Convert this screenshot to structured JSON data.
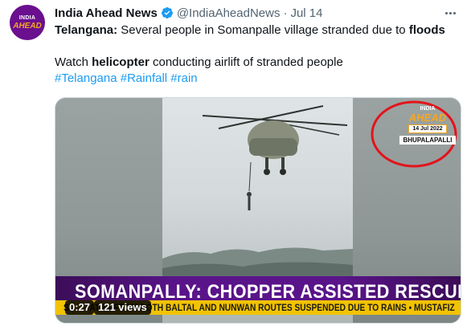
{
  "tweet": {
    "author_name": "India Ahead News",
    "handle": "@IndiaAheadNews",
    "separator": "·",
    "date": "Jul 14",
    "line1_bold": "Telangana:",
    "line1_text": " Several people in Somanpalle village stranded due to ",
    "line1_bold2": "floods",
    "line2_prefix": "Watch ",
    "line2_bold": "helicopter",
    "line2_suffix": " conducting airlift of stranded people",
    "hashtags": [
      "#Telangana",
      "#Rainfall",
      "#rain"
    ]
  },
  "avatar": {
    "line1": "INDIA",
    "line2": "AHEAD"
  },
  "video": {
    "logo_line1": "INDIA",
    "logo_line2": "AHEAD",
    "logo_date": "14 Jul 2022",
    "logo_location": "BHUPALAPALLI",
    "headline": "SOMANPALLY: CHOPPER ASSISTED RESCUE OP",
    "ticker": "S | ... YATRA FROM BOTH BALTAL AND NUNWAN ROUTES SUSPENDED DUE TO RAINS  •  MUSTAFIZ",
    "duration": "0:27",
    "views": "121 views"
  },
  "icons": {
    "verified": "verified-badge-icon",
    "more": "more-options-icon",
    "helicopter": "helicopter-image"
  },
  "colors": {
    "link": "#1d9bf0",
    "verified": "#1d9bf0",
    "banner": "#5a148a",
    "ticker": "#f2c300",
    "circle": "#e3131b"
  }
}
